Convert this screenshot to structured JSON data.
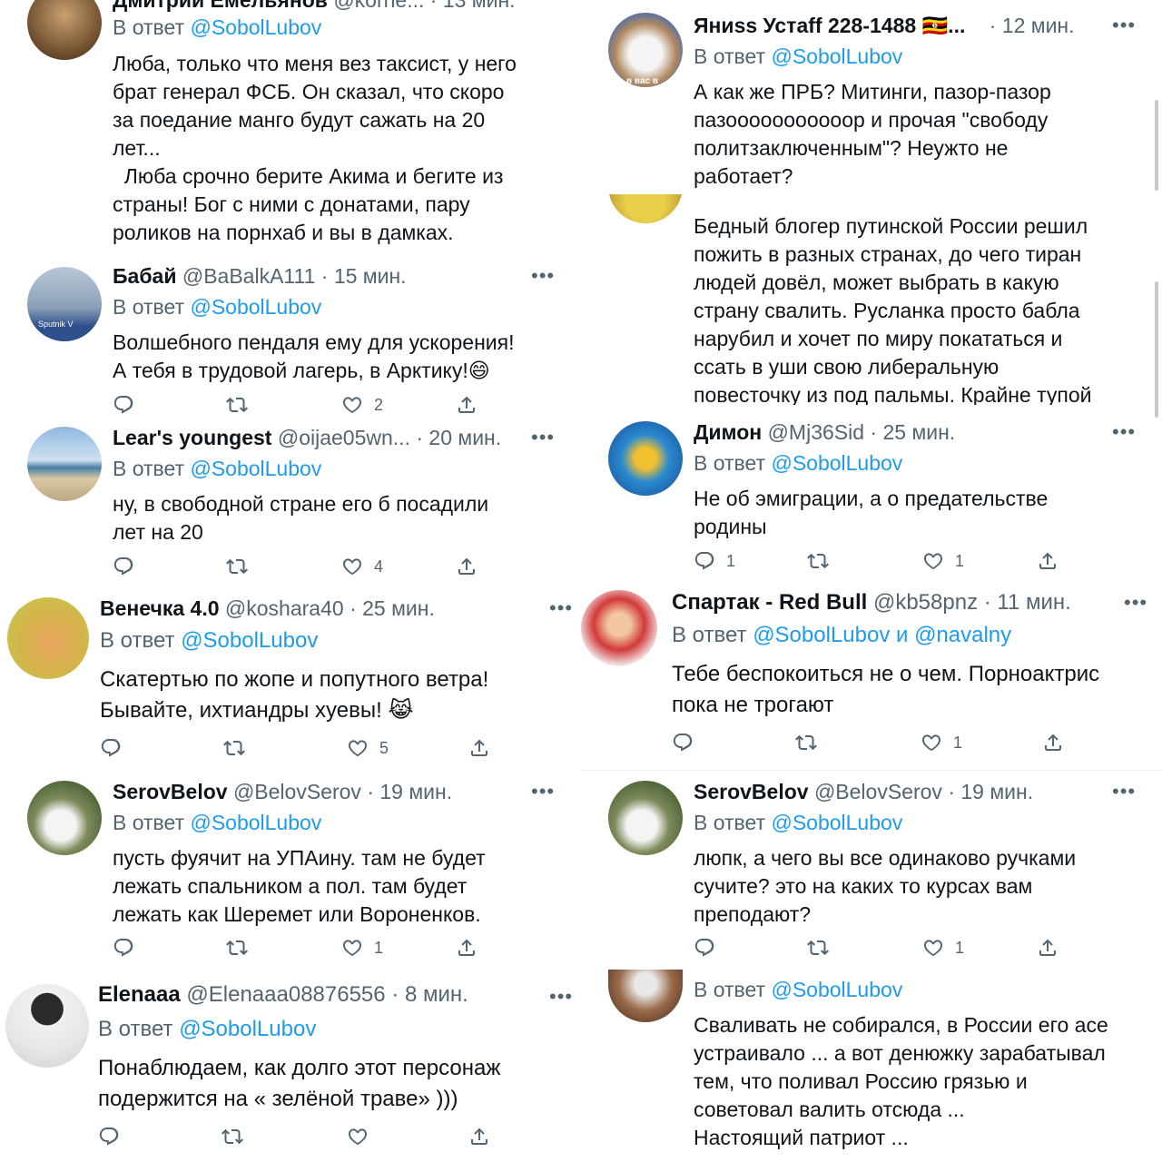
{
  "left": [
    {
      "name": "Дмитрий Емельянов",
      "handle": "@korne...",
      "time": "· 13 мин.",
      "reply_prefix": "В ответ",
      "reply_to": "@SobolLubov",
      "text": "Люба, только что меня вез таксист, у него\nбрат генерал ФСБ. Он сказал, что скоро\nза поедание манго будут сажать на 20\nлет...\n  Люба срочно берите Акима и бегите из\nстраны! Бог с ними с донатами, пару\nроликов на порнхаб и вы в дамках."
    },
    {
      "name": "Бабай",
      "handle": "@BaBalkA111",
      "time": "· 15 мин.",
      "reply_prefix": "В ответ",
      "reply_to": "@SobolLubov",
      "text": "Волшебного пендаля ему для ускорения!\nА тебя в трудовой лагерь, в Арктику!😄",
      "likes": "2",
      "avatar_text": "Sputnik V"
    },
    {
      "name": "Lear's youngest",
      "handle": "@oijae05wn...",
      "time": "· 20 мин.",
      "reply_prefix": "В ответ",
      "reply_to": "@SobolLubov",
      "text": "ну, в свободной стране его б посадили\nлет на 20",
      "likes": "4"
    },
    {
      "name": "Венечка 4.0",
      "handle": "@koshara40",
      "time": "· 25 мин.",
      "reply_prefix": "В ответ",
      "reply_to": "@SobolLubov",
      "text": "Скатертью по жопе и попутного ветра!\nБывайте, ихтиандры хуевы! 😹",
      "likes": "5"
    },
    {
      "name": "SerovBelov",
      "handle": "@BelovSerov",
      "time": "· 19 мин.",
      "reply_prefix": "В ответ",
      "reply_to": "@SobolLubov",
      "text": "пусть фуячит на УПАину. там не будет\nлежать спальником а пол. там будет\nлежать как Шеремет или Вороненков.",
      "likes": "1"
    },
    {
      "name": "Elenaaa",
      "handle": "@Elenaaa08876556",
      "time": "· 8 мин.",
      "reply_prefix": "В ответ",
      "reply_to": "@SobolLubov",
      "text": "Понаблюдаем, как долго этот персонаж\nподержится на « зелёной траве» )))"
    }
  ],
  "right": [
    {
      "name": "Яниss Устаff 228-1488 🇺🇬...",
      "time": "· 12 мин.",
      "reply_prefix": "В ответ",
      "reply_to": "@SobolLubov",
      "text": "А как же ПРБ? Митинги, пазор-пазор\nпазооооооооооор и прочая \"свободу\nполитзаключенным\"? Неужто не\nработает?",
      "avatar_text": "в вас в"
    },
    {
      "text": "Бедный блогер путинской России решил\nпожить в разных странах, до чего тиран\nлюдей довёл, может выбрать в какую\nстрану свалить. Русланка просто бабла\nнарубил и хочет по миру покататься и\nссать в уши свою либеральную\nповесточку из под пальмы. Крайне тупой"
    },
    {
      "name": "Димон",
      "handle": "@Mj36Sid",
      "time": "· 25 мин.",
      "reply_prefix": "В ответ",
      "reply_to": "@SobolLubov",
      "text": "Не об эмиграции, а о предательстве\nродины",
      "replies": "1",
      "likes": "1"
    },
    {
      "name": "Спартак - Red Bull",
      "handle": "@kb58pnz",
      "time": "· 11 мин.",
      "reply_prefix": "В ответ",
      "reply_to": "@SobolLubov и @navalny",
      "text": "Тебе беспокоиться не о чем. Порноактрис\nпока не трогают",
      "likes": "1"
    },
    {
      "name": "SerovBelov",
      "handle": "@BelovSerov",
      "time": "· 19 мин.",
      "reply_prefix": "В ответ",
      "reply_to": "@SobolLubov",
      "text": "люпк, а чего вы все одинаково ручками\nсучите? это на каких то курсах вам\nпреподают?",
      "likes": "1"
    },
    {
      "reply_prefix": "В ответ",
      "reply_to": "@SobolLubov",
      "text": "Сваливать не собирался, в России его асе\nустраивало ... а вот денюжку зарабатывал\nтем, что поливал Россию грязью и\nсоветовал валить отсюда ...\nНастоящий патриот ..."
    }
  ],
  "colors": {
    "link": "#1d9bf0",
    "muted": "#536471",
    "text": "#0f1419"
  }
}
